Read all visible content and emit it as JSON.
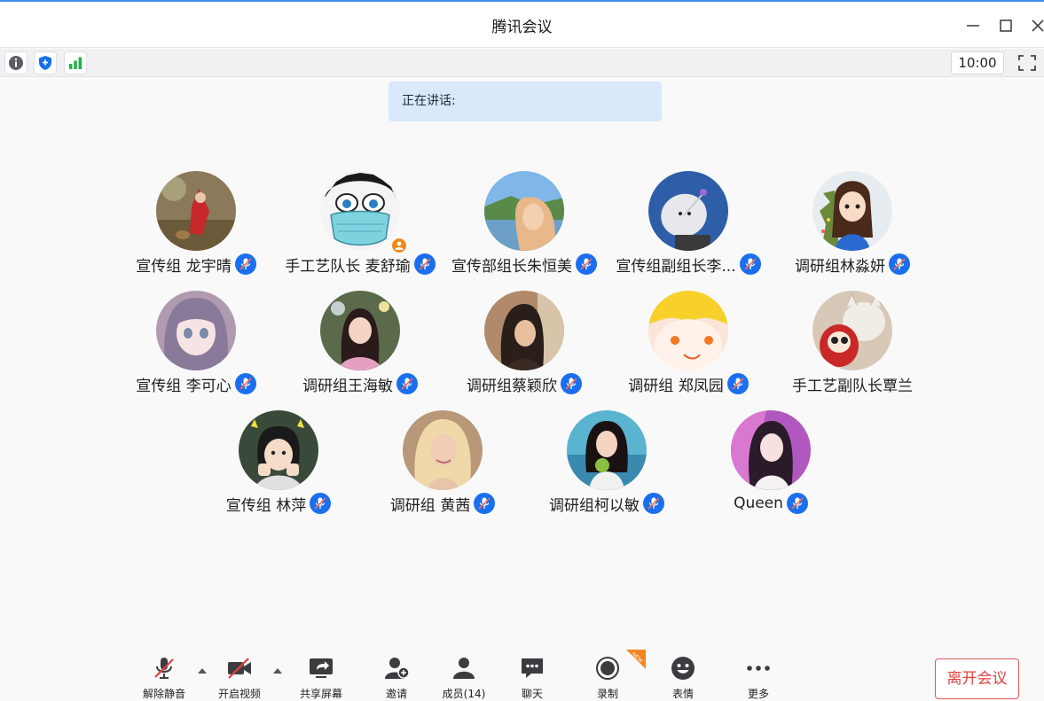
{
  "window": {
    "title": "腾讯会议"
  },
  "status": {
    "clock": "10:00"
  },
  "speaking": {
    "text": "正在讲话:"
  },
  "participants": [
    {
      "name": "宣传组 龙宇晴",
      "mic": "mic-muted-icon"
    },
    {
      "name": "手工艺队长 麦舒瑜",
      "mic": "mic-muted-icon",
      "host": true
    },
    {
      "name": "宣传部组长朱恒美",
      "mic": "mic-muted-icon"
    },
    {
      "name": "宣传组副组长李...",
      "mic": "mic-muted-icon"
    },
    {
      "name": "调研组林淼妍",
      "mic": "mic-muted-icon"
    },
    {
      "name": "宣传组 李可心",
      "mic": "mic-muted-icon"
    },
    {
      "name": "调研组王海敏",
      "mic": "mic-muted-icon"
    },
    {
      "name": "调研组蔡颖欣",
      "mic": "mic-muted-icon"
    },
    {
      "name": "调研组 郑凤园",
      "mic": "mic-muted-icon"
    },
    {
      "name": "手工艺副队长覃兰",
      "mic": ""
    },
    {
      "name": "宣传组 林萍",
      "mic": "mic-muted-icon"
    },
    {
      "name": "调研组 黄茜",
      "mic": "mic-muted-icon"
    },
    {
      "name": "调研组柯以敏",
      "mic": "mic-muted-icon"
    },
    {
      "name": "Queen",
      "mic": "mic-muted-icon"
    }
  ],
  "toolbar": {
    "unmute": "解除静音",
    "video": "开启视频",
    "share": "共享屏幕",
    "invite": "邀请",
    "members": "成员(14)",
    "chat": "聊天",
    "record": "录制",
    "record_badge": "NEW",
    "emoji": "表情",
    "more": "更多",
    "leave": "离开会议"
  },
  "colors": {
    "accent": "#1a6ff0",
    "speaking_bg": "#d9e8fb",
    "leave": "#e0403e",
    "host_badge": "#f08a1d",
    "new_badge": "#f5861f"
  }
}
